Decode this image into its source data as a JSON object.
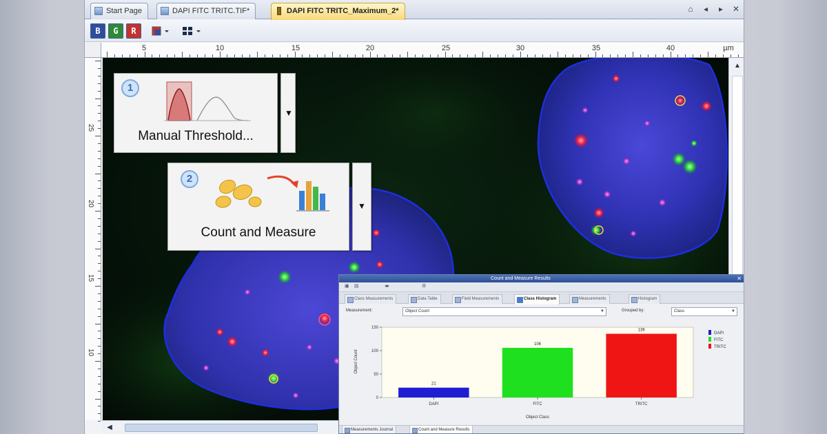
{
  "tabs": [
    {
      "label": "Start Page",
      "active": false
    },
    {
      "label": "DAPI FITC TRITC.TIF*",
      "active": false
    },
    {
      "label": "DAPI FITC TRITC_Maximum_2*",
      "active": true
    }
  ],
  "toolbar": {
    "channel_buttons": [
      "B",
      "G",
      "R"
    ]
  },
  "ruler": {
    "ticks": [
      5,
      10,
      15,
      20,
      25,
      30,
      35,
      40
    ],
    "unit": "µm",
    "vertical_ticks": [
      25,
      20,
      15,
      10
    ]
  },
  "steps": [
    {
      "number": "1",
      "label": "Manual Threshold..."
    },
    {
      "number": "2",
      "label": "Count and Measure"
    }
  ],
  "results": {
    "title": "Count and Measure Results",
    "tabs": [
      {
        "label": "Class Measurements",
        "active": false
      },
      {
        "label": "Data Table",
        "active": false
      },
      {
        "label": "Field Measurements",
        "active": false
      },
      {
        "label": "Class Histogram",
        "active": true
      },
      {
        "label": "Measurements",
        "active": false
      },
      {
        "label": "Histogram",
        "active": false
      }
    ],
    "measurement_label": "Measurement:",
    "measurement_value": "Object Count",
    "grouped_by_label": "Grouped by:",
    "grouped_by_value": "Class",
    "bottom_tabs": [
      {
        "label": "Measurements Journal",
        "active": false
      },
      {
        "label": "Count and Measure Results",
        "active": true
      }
    ]
  },
  "chart_data": {
    "type": "bar",
    "categories": [
      "DAPI",
      "FITC",
      "TRITC"
    ],
    "values": [
      21,
      106,
      136
    ],
    "data_labels": [
      "21",
      "106",
      "136"
    ],
    "colors": [
      "#1f1fd1",
      "#1fe01f",
      "#ef1515"
    ],
    "legend": [
      {
        "name": "DAPI",
        "color": "#1f1fd1"
      },
      {
        "name": "FITC",
        "color": "#1fe01f"
      },
      {
        "name": "TRITC",
        "color": "#ef1515"
      }
    ],
    "legend_position": "right",
    "xlabel": "Object Class",
    "ylabel": "Object Count",
    "ylim": [
      0,
      150
    ],
    "yticks": [
      0,
      50,
      100,
      150
    ],
    "grid": false
  }
}
